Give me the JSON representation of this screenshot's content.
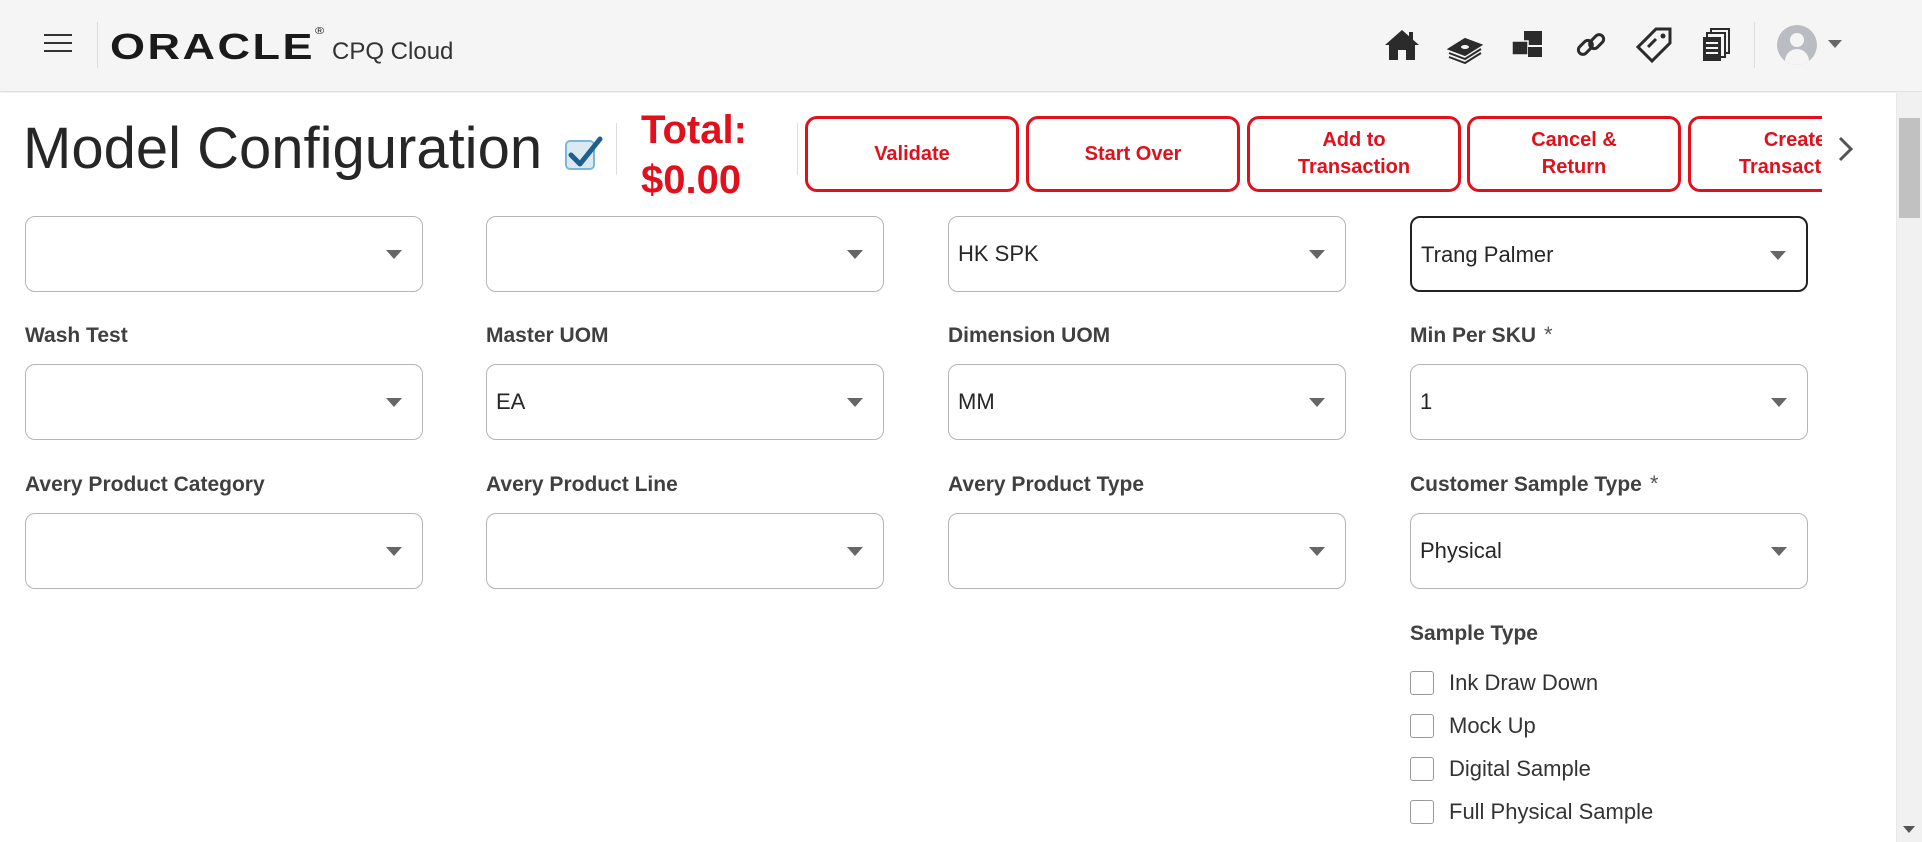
{
  "header": {
    "logo_text": "ORACLE",
    "product": "CPQ Cloud",
    "icons": [
      "home-icon",
      "money-icon",
      "products-icon",
      "link-icon",
      "tag-icon",
      "documents-icon"
    ]
  },
  "title": {
    "page_title": "Model Configuration",
    "total_label": "Total:",
    "total_value": "$0.00"
  },
  "actions": {
    "validate": "Validate",
    "start_over": "Start Over",
    "add_to_transaction": "Add to\nTransaction",
    "cancel_return": "Cancel &\nReturn",
    "create_transaction": "Create\nTransaction"
  },
  "form": {
    "row0": [
      {
        "value": ""
      },
      {
        "value": ""
      },
      {
        "value": "HK SPK"
      },
      {
        "value": "Trang Palmer"
      }
    ],
    "row1": [
      {
        "label": "Wash Test",
        "value": ""
      },
      {
        "label": "Master UOM",
        "value": "EA"
      },
      {
        "label": "Dimension UOM",
        "value": "MM"
      },
      {
        "label": "Min Per SKU",
        "value": "1",
        "required": "*"
      }
    ],
    "row2": [
      {
        "label": "Avery Product Category",
        "value": ""
      },
      {
        "label": "Avery Product Line",
        "value": ""
      },
      {
        "label": "Avery Product Type",
        "value": ""
      },
      {
        "label": "Customer Sample Type",
        "value": "Physical",
        "required": "*"
      }
    ],
    "sample_type": {
      "label": "Sample Type",
      "options": [
        "Ink Draw Down",
        "Mock Up",
        "Digital Sample",
        "Full Physical Sample"
      ]
    }
  },
  "colors": {
    "accent": "#e0111c"
  }
}
